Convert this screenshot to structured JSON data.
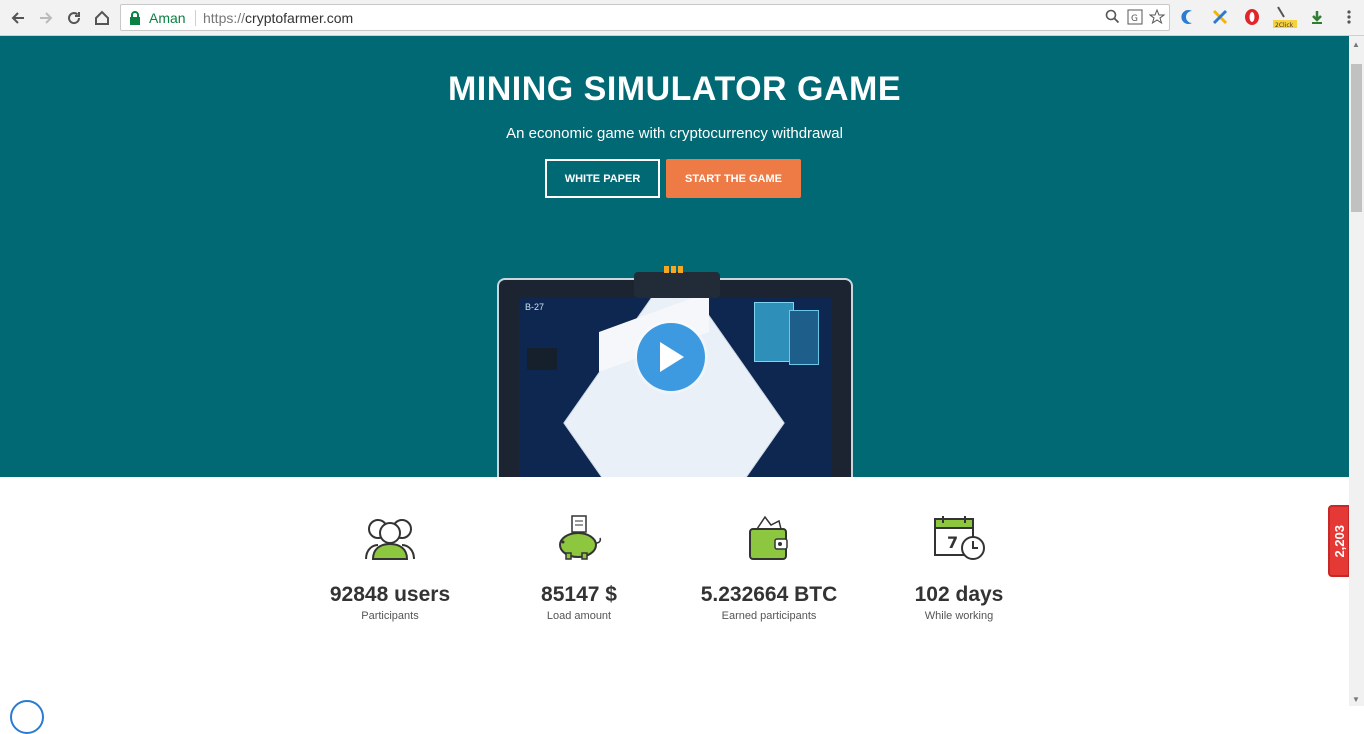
{
  "browser": {
    "site_label": "Aman",
    "url_protocol": "https://",
    "url_host": "cryptofarmer.com",
    "ext_badge": "2Click"
  },
  "hero": {
    "title": "MINING SIMULATOR GAME",
    "subtitle": "An economic game with cryptocurrency withdrawal",
    "white_paper_label": "WHITE PAPER",
    "start_label": "START THE GAME",
    "video_tag": "B-27"
  },
  "stats": [
    {
      "value": "92848  users",
      "label": "Participants",
      "icon": "users-icon"
    },
    {
      "value": "85147  $",
      "label": "Load amount",
      "icon": "piggy-bank-icon"
    },
    {
      "value": "5.232664  BTC",
      "label": "Earned participants",
      "icon": "wallet-icon"
    },
    {
      "value": "102  days",
      "label": "While working",
      "icon": "calendar-clock-icon",
      "icon_day": "7"
    }
  ],
  "side_widget": {
    "count": "2,203"
  },
  "colors": {
    "hero_bg": "#016974",
    "accent": "#ee7b45",
    "icon_green": "#8dc63f"
  }
}
